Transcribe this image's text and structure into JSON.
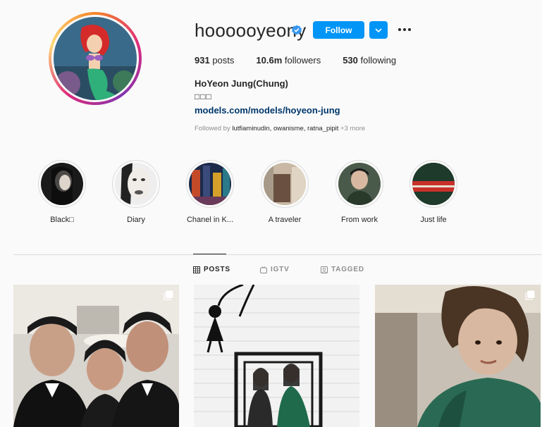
{
  "profile": {
    "username": "hoooooyeony",
    "follow_label": "Follow",
    "stats": {
      "posts": "931",
      "posts_label": "posts",
      "followers": "10.6m",
      "followers_label": "followers",
      "following": "530",
      "following_label": "following"
    },
    "full_name": "HoYeon Jung(Chung)",
    "bio": "□□□",
    "link": "models.com/models/hoyeon-jung",
    "followed_by_prefix": "Followed by",
    "followed_by_names": "lutfiaminudin, owanisme, ratna_pipit",
    "followed_by_more": "+3 more"
  },
  "highlights": [
    {
      "label": "Black□",
      "icon": "portrait-dark"
    },
    {
      "label": "Diary",
      "icon": "portrait-face"
    },
    {
      "label": "Chanel in K...",
      "icon": "city-night"
    },
    {
      "label": "A traveler",
      "icon": "room"
    },
    {
      "label": "From work",
      "icon": "portrait-green"
    },
    {
      "label": "Just life",
      "icon": "stripes"
    }
  ],
  "tabs": [
    {
      "label": "POSTS",
      "icon": "grid-icon",
      "active": true
    },
    {
      "label": "IGTV",
      "icon": "igtv-icon",
      "active": false
    },
    {
      "label": "TAGGED",
      "icon": "tagged-icon",
      "active": false
    }
  ],
  "colors": {
    "accent": "#0095f6",
    "link": "#00376b",
    "muted": "#8e8e8e",
    "verified": "#3897f0"
  }
}
